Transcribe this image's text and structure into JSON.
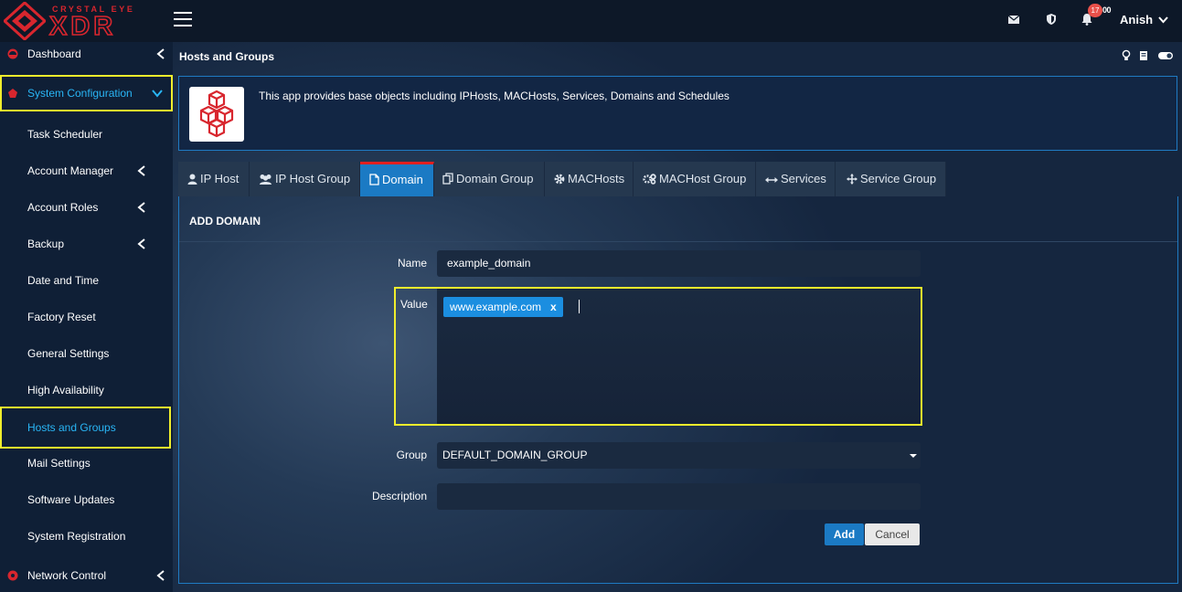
{
  "brand": {
    "tagline": "CRYSTAL EYE",
    "name": "XDR"
  },
  "header": {
    "notification_count": "17",
    "notification_count2": "00",
    "user_name": "Anish"
  },
  "sidebar": {
    "items": [
      {
        "label": "Dashboard",
        "icon": "dashboard-icon"
      },
      {
        "label": "System Configuration",
        "icon": "system-configuration-icon"
      },
      {
        "label": "Task Scheduler"
      },
      {
        "label": "Account Manager"
      },
      {
        "label": "Account Roles"
      },
      {
        "label": "Backup"
      },
      {
        "label": "Date and Time"
      },
      {
        "label": "Factory Reset"
      },
      {
        "label": "General Settings"
      },
      {
        "label": "High Availability"
      },
      {
        "label": "Hosts and Groups"
      },
      {
        "label": "Mail Settings"
      },
      {
        "label": "Software Updates"
      },
      {
        "label": "System Registration"
      },
      {
        "label": "Network Control",
        "icon": "network-control-icon"
      }
    ]
  },
  "page": {
    "title": "Hosts and Groups",
    "app_description": "This app provides base objects including IPHosts, MACHosts, Services, Domains and Schedules"
  },
  "tabs": [
    {
      "label": "IP Host",
      "icon": "user-icon"
    },
    {
      "label": "IP Host Group",
      "icon": "users-icon"
    },
    {
      "label": "Domain",
      "icon": "file-icon"
    },
    {
      "label": "Domain Group",
      "icon": "copy-icon"
    },
    {
      "label": "MACHosts",
      "icon": "gear-icon"
    },
    {
      "label": "MACHost Group",
      "icon": "gears-icon"
    },
    {
      "label": "Services",
      "icon": "arrows-horizontal-icon"
    },
    {
      "label": "Service Group",
      "icon": "move-icon"
    }
  ],
  "form": {
    "title": "ADD DOMAIN",
    "name_label": "Name",
    "name_value": "example_domain",
    "value_label": "Value",
    "value_tag": "www.example.com",
    "tag_remove": "x",
    "group_label": "Group",
    "group_value": "DEFAULT_DOMAIN_GROUP",
    "description_label": "Description",
    "description_value": "",
    "add_label": "Add",
    "cancel_label": "Cancel"
  },
  "colors": {
    "accent": "#1b7ac4",
    "highlight": "#f0ee2c",
    "brand_red": "#d8262e",
    "active_text": "#29b6f6"
  }
}
